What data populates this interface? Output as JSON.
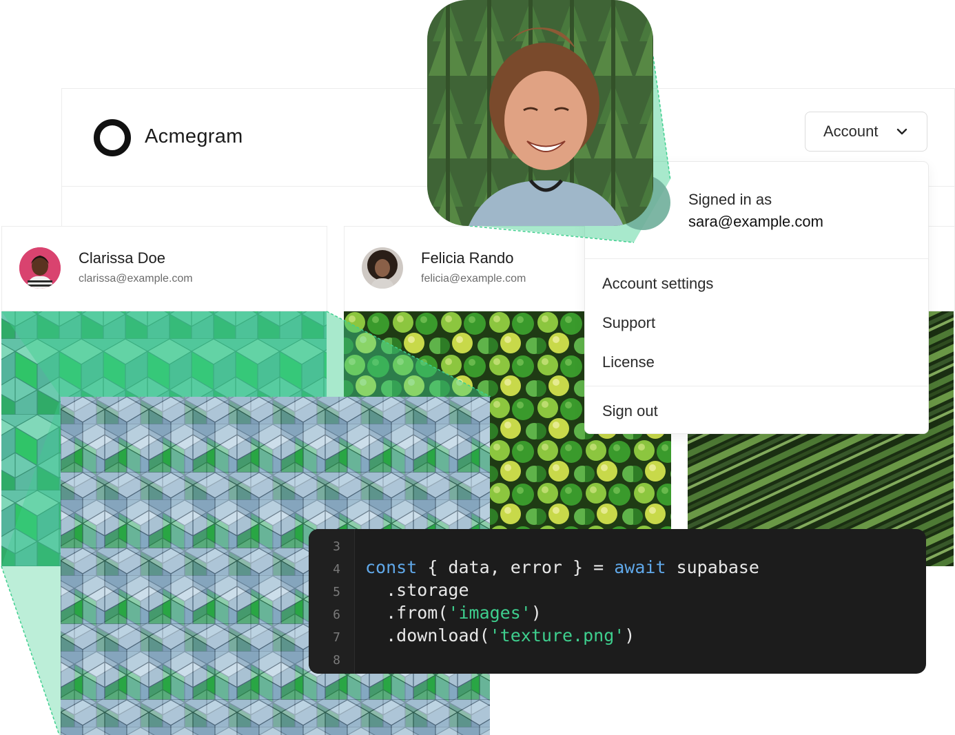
{
  "header": {
    "app_title": "Acmegram",
    "account_button_label": "Account"
  },
  "dropdown": {
    "signed_in_label": "Signed in as",
    "signed_in_email": "sara@example.com",
    "items": [
      {
        "label": "Account settings"
      },
      {
        "label": "Support"
      },
      {
        "label": "License"
      }
    ],
    "sign_out_label": "Sign out"
  },
  "cards": [
    {
      "name": "Clarissa Doe",
      "email": "clarissa@example.com"
    },
    {
      "name": "Felicia Rando",
      "email": "felicia@example.com"
    }
  ],
  "code": {
    "line_numbers": [
      "3",
      "4",
      "5",
      "6",
      "7",
      "8"
    ],
    "lines": [
      {
        "parts": [
          {
            "text": "const",
            "kind": "kw"
          },
          {
            "text": " { data, error } = ",
            "kind": "plain"
          },
          {
            "text": "await",
            "kind": "kw"
          },
          {
            "text": " supabase",
            "kind": "plain"
          }
        ]
      },
      {
        "parts": [
          {
            "text": "  .storage",
            "kind": "plain"
          }
        ]
      },
      {
        "parts": [
          {
            "text": "  .from(",
            "kind": "plain"
          },
          {
            "text": "'images'",
            "kind": "str"
          },
          {
            "text": ")",
            "kind": "plain"
          }
        ]
      },
      {
        "parts": [
          {
            "text": "  .download(",
            "kind": "plain"
          },
          {
            "text": "'texture.png'",
            "kind": "str"
          },
          {
            "text": ")",
            "kind": "plain"
          }
        ]
      }
    ]
  },
  "colors": {
    "accent_green": "#3ecf8e",
    "code_background": "#1c1c1c",
    "keyword": "#60a8e9"
  },
  "icons": [
    "logo-ring-icon",
    "chevron-down-icon"
  ]
}
